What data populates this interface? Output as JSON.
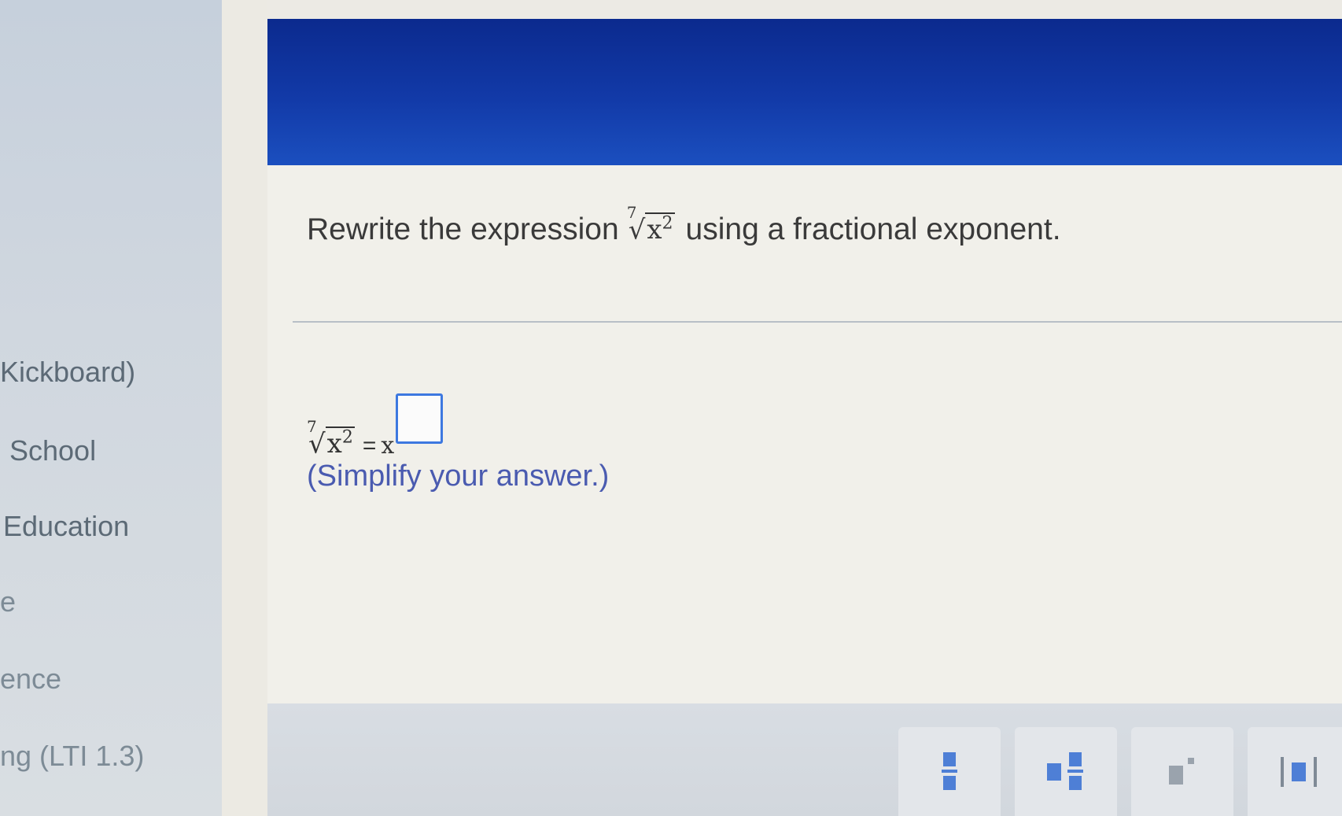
{
  "sidebar": {
    "items": [
      {
        "label": "Kickboard)"
      },
      {
        "label": "School"
      },
      {
        "label": "Education"
      },
      {
        "label": "e"
      },
      {
        "label": "ence"
      },
      {
        "label": "ng (LTI 1.3)"
      }
    ]
  },
  "question": {
    "prefix": "Rewrite the expression",
    "suffix": "using a fractional exponent.",
    "radical_index": "7",
    "radical_base": "x",
    "radical_power": "2"
  },
  "answer": {
    "radical_index": "7",
    "radical_base": "x",
    "radical_power": "2",
    "equals": "=",
    "base": "x",
    "exponent_value": "",
    "hint": "(Simplify your answer.)"
  },
  "toolbar": {
    "buttons": [
      {
        "name": "fraction",
        "icon": "fraction-icon"
      },
      {
        "name": "mixed-number",
        "icon": "mixed-number-icon"
      },
      {
        "name": "exponent",
        "icon": "exponent-icon"
      },
      {
        "name": "absolute-value",
        "icon": "absolute-value-icon"
      }
    ]
  },
  "colors": {
    "header": "#123aa8",
    "accent": "#3d78e0",
    "hint_text": "#4a5bb0"
  }
}
